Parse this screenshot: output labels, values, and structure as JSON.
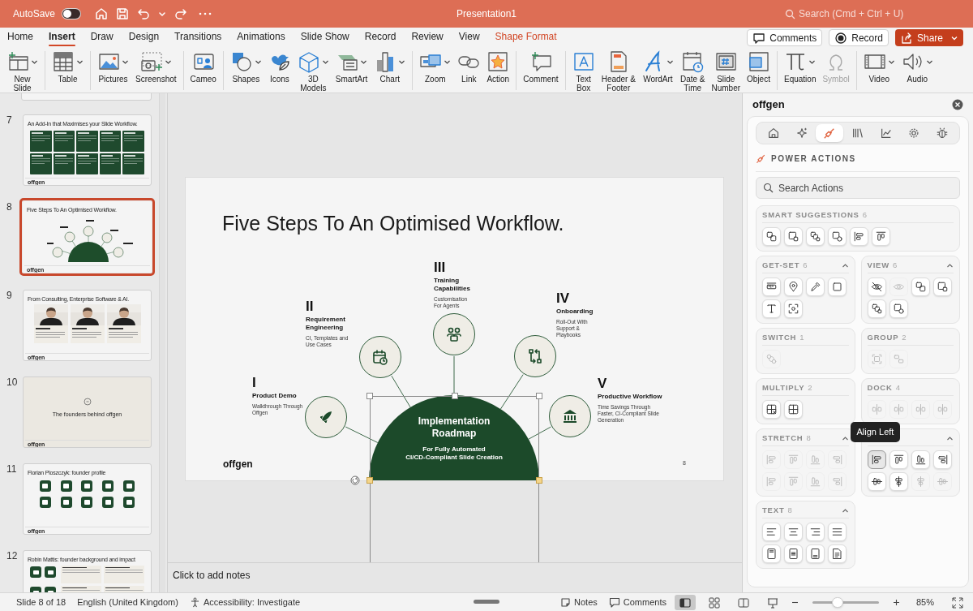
{
  "title_bar": {
    "autosave_label": "AutoSave",
    "autosave_on": false,
    "title": "Presentation1",
    "search_placeholder": "Search (Cmd + Ctrl + U)"
  },
  "tabs": [
    {
      "label": "Home",
      "selected": false,
      "kind": "normal"
    },
    {
      "label": "Insert",
      "selected": true,
      "kind": "normal"
    },
    {
      "label": "Draw",
      "selected": false,
      "kind": "normal"
    },
    {
      "label": "Design",
      "selected": false,
      "kind": "normal"
    },
    {
      "label": "Transitions",
      "selected": false,
      "kind": "normal"
    },
    {
      "label": "Animations",
      "selected": false,
      "kind": "normal"
    },
    {
      "label": "Slide Show",
      "selected": false,
      "kind": "normal"
    },
    {
      "label": "Record",
      "selected": false,
      "kind": "normal"
    },
    {
      "label": "Review",
      "selected": false,
      "kind": "normal"
    },
    {
      "label": "View",
      "selected": false,
      "kind": "normal"
    },
    {
      "label": "Shape Format",
      "selected": false,
      "kind": "contextual"
    }
  ],
  "header_buttons": [
    {
      "label": "Comments",
      "kind": "outline"
    },
    {
      "label": "Record",
      "kind": "outline"
    },
    {
      "label": "Share",
      "kind": "primary"
    }
  ],
  "ribbon_groups": [
    [
      {
        "label": "New\nSlide",
        "dropdown": true,
        "disabled": false
      }
    ],
    [
      {
        "label": "Table",
        "dropdown": true,
        "disabled": false
      }
    ],
    [
      {
        "label": "Pictures",
        "dropdown": true,
        "disabled": false
      },
      {
        "label": "Screenshot",
        "dropdown": true,
        "disabled": false
      }
    ],
    [
      {
        "label": "Cameo",
        "dropdown": false,
        "disabled": false
      }
    ],
    [
      {
        "label": "Shapes",
        "dropdown": true,
        "disabled": false
      },
      {
        "label": "Icons",
        "dropdown": false,
        "disabled": false
      },
      {
        "label": "3D\nModels",
        "dropdown": true,
        "disabled": false
      },
      {
        "label": "SmartArt",
        "dropdown": true,
        "disabled": false
      },
      {
        "label": "Chart",
        "dropdown": true,
        "disabled": false
      }
    ],
    [
      {
        "label": "Zoom",
        "dropdown": true,
        "disabled": false
      },
      {
        "label": "Link",
        "dropdown": false,
        "disabled": false
      },
      {
        "label": "Action",
        "dropdown": false,
        "disabled": false
      }
    ],
    [
      {
        "label": "Comment",
        "dropdown": false,
        "disabled": false
      }
    ],
    [
      {
        "label": "Text\nBox",
        "dropdown": false,
        "disabled": false
      },
      {
        "label": "Header &\nFooter",
        "dropdown": false,
        "disabled": false
      },
      {
        "label": "WordArt",
        "dropdown": true,
        "disabled": false
      },
      {
        "label": "Date &\nTime",
        "dropdown": false,
        "disabled": false
      },
      {
        "label": "Slide\nNumber",
        "dropdown": false,
        "disabled": false
      },
      {
        "label": "Object",
        "dropdown": false,
        "disabled": false
      }
    ],
    [
      {
        "label": "Equation",
        "dropdown": true,
        "disabled": false
      },
      {
        "label": "Symbol",
        "dropdown": false,
        "disabled": true
      }
    ],
    [
      {
        "label": "Video",
        "dropdown": true,
        "disabled": false
      },
      {
        "label": "Audio",
        "dropdown": true,
        "disabled": false
      }
    ]
  ],
  "slide_panel": [
    {
      "number": "7",
      "title": "An Add-In that Maximises your Slide Workflow.",
      "selected": false,
      "kind": "cards",
      "footer": "offgen"
    },
    {
      "number": "8",
      "title": "Five Steps To An Optimised Workflow.",
      "selected": true,
      "kind": "diagram",
      "footer": "offgen"
    },
    {
      "number": "9",
      "title": "From Consulting, Enterprise Software & AI.",
      "selected": false,
      "kind": "people",
      "footer": "offgen"
    },
    {
      "number": "10",
      "title": "The founders behind offgen",
      "selected": false,
      "kind": "section",
      "footer": "offgen"
    },
    {
      "number": "11",
      "title": "Florian Ploszczyk: founder profile",
      "selected": false,
      "kind": "icons",
      "footer": "offgen"
    },
    {
      "number": "12",
      "title": "Robin Mattis: founder background and impact",
      "selected": false,
      "kind": "mixed"
    }
  ],
  "slide": {
    "title": "Five Steps To An Optimised Workflow.",
    "steps": [
      {
        "numeral": "I",
        "heading": "Product Demo",
        "description": "Walkthrough Through\nOffgen"
      },
      {
        "numeral": "II",
        "heading": "Requirement\nEngineering",
        "description": "CI, Templates and\nUse Cases"
      },
      {
        "numeral": "III",
        "heading": "Training\nCapabilities",
        "description": "Customisation\nFor Agents"
      },
      {
        "numeral": "IV",
        "heading": "Onboarding",
        "description": "Roll-Out With\nSupport &\nPlaybooks"
      },
      {
        "numeral": "V",
        "heading": "Productive Workflow",
        "description": "Time Savings Through\nFaster, CI-Compliant Slide\nGeneration"
      }
    ],
    "center_title": "Implementation\nRoadmap",
    "center_subtitle": "For Fully Automated\nCI/CD-Compliant Slide Creation",
    "logo": "offgen",
    "page_number": "8"
  },
  "notes": {
    "placeholder": "Click to add notes"
  },
  "task_pane": {
    "title": "offgen",
    "tabs": [
      {
        "selected": false
      },
      {
        "selected": false
      },
      {
        "selected": true
      },
      {
        "selected": false
      },
      {
        "selected": false
      },
      {
        "selected": false
      },
      {
        "selected": false
      }
    ],
    "section_title": "POWER ACTIONS",
    "search_placeholder": "Search Actions",
    "tooltip": "Align Left",
    "groups": [
      {
        "title": "SMART SUGGESTIONS",
        "count": "6",
        "collapsible": false,
        "actions": [
          {
            "disabled": false,
            "pressed": false
          },
          {
            "disabled": false,
            "pressed": false
          },
          {
            "disabled": false,
            "pressed": false
          },
          {
            "disabled": false,
            "pressed": false
          },
          {
            "disabled": false,
            "pressed": false
          },
          {
            "disabled": false,
            "pressed": false
          }
        ]
      },
      {
        "title": "GET-SET",
        "count": "6",
        "collapsible": true,
        "actions": [
          {
            "disabled": false,
            "pressed": false
          },
          {
            "disabled": false,
            "pressed": false
          },
          {
            "disabled": false,
            "pressed": false
          },
          {
            "disabled": false,
            "pressed": false
          },
          {
            "disabled": false,
            "pressed": false
          },
          {
            "disabled": false,
            "pressed": false
          }
        ]
      },
      {
        "title": "VIEW",
        "count": "6",
        "collapsible": true,
        "actions": [
          {
            "disabled": false,
            "pressed": false
          },
          {
            "disabled": true,
            "pressed": false
          },
          {
            "disabled": false,
            "pressed": false
          },
          {
            "disabled": false,
            "pressed": false
          },
          {
            "disabled": false,
            "pressed": false
          },
          {
            "disabled": false,
            "pressed": false
          }
        ]
      },
      {
        "title": "SWITCH",
        "count": "1",
        "collapsible": false,
        "actions": [
          {
            "disabled": true,
            "pressed": false
          }
        ]
      },
      {
        "title": "GROUP",
        "count": "2",
        "collapsible": false,
        "actions": [
          {
            "disabled": true,
            "pressed": false
          },
          {
            "disabled": true,
            "pressed": false
          }
        ]
      },
      {
        "title": "MULTIPLY",
        "count": "2",
        "collapsible": false,
        "actions": [
          {
            "disabled": false,
            "pressed": false
          },
          {
            "disabled": false,
            "pressed": false
          }
        ]
      },
      {
        "title": "DOCK",
        "count": "4",
        "collapsible": false,
        "actions": [
          {
            "disabled": true,
            "pressed": false
          },
          {
            "disabled": true,
            "pressed": false
          },
          {
            "disabled": true,
            "pressed": false
          },
          {
            "disabled": true,
            "pressed": false
          }
        ]
      },
      {
        "title": "STRETCH",
        "count": "8",
        "collapsible": true,
        "actions": [
          {
            "disabled": true,
            "pressed": false
          },
          {
            "disabled": true,
            "pressed": false
          },
          {
            "disabled": true,
            "pressed": false
          },
          {
            "disabled": true,
            "pressed": false
          },
          {
            "disabled": true,
            "pressed": false
          },
          {
            "disabled": true,
            "pressed": false
          },
          {
            "disabled": true,
            "pressed": false
          },
          {
            "disabled": true,
            "pressed": false
          }
        ]
      },
      {
        "collapsible": true,
        "actions": [
          {
            "disabled": false,
            "pressed": true
          },
          {
            "disabled": false,
            "pressed": false
          },
          {
            "disabled": false,
            "pressed": false
          },
          {
            "disabled": false,
            "pressed": false
          },
          {
            "disabled": false,
            "pressed": false
          },
          {
            "disabled": false,
            "pressed": false
          },
          {
            "disabled": true,
            "pressed": false
          },
          {
            "disabled": true,
            "pressed": false
          }
        ]
      },
      {
        "title": "TEXT",
        "count": "8",
        "collapsible": true,
        "actions": [
          {
            "disabled": false,
            "pressed": false
          },
          {
            "disabled": false,
            "pressed": false
          },
          {
            "disabled": false,
            "pressed": false
          },
          {
            "disabled": false,
            "pressed": false
          },
          {
            "disabled": false,
            "pressed": false
          },
          {
            "disabled": false,
            "pressed": false
          },
          {
            "disabled": false,
            "pressed": false
          },
          {
            "disabled": false,
            "pressed": false
          }
        ]
      }
    ]
  },
  "status_bar": {
    "slide_info": "Slide 8 of 18",
    "language": "English (United Kingdom)",
    "accessibility": "Accessibility: Investigate",
    "notes": "Notes",
    "comments": "Comments",
    "views": [
      {
        "selected": true
      },
      {
        "selected": false
      },
      {
        "selected": false
      },
      {
        "selected": false
      }
    ],
    "zoom": {
      "level": 0.38,
      "reading": "85%"
    }
  }
}
